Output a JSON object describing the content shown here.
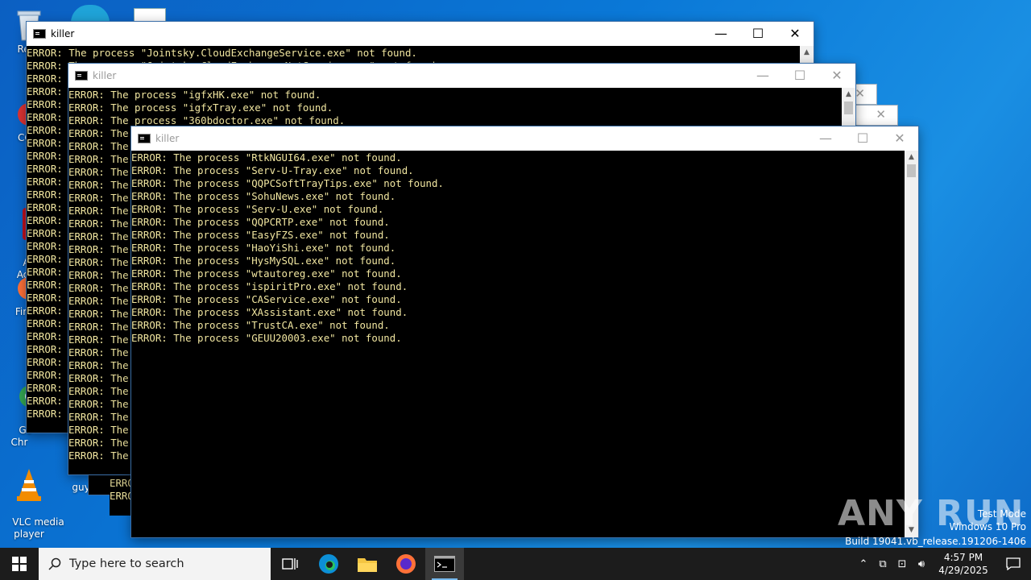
{
  "desktop_icons": [
    {
      "label": "Recy"
    },
    {
      "label": "CCl"
    },
    {
      "label": "Ac\nAc"
    },
    {
      "label": "Fir"
    },
    {
      "label": "Go\nChr"
    },
    {
      "label": "VLC media\nplayer"
    },
    {
      "label": "guypa"
    }
  ],
  "windows": {
    "back": {
      "title": "killer",
      "lines": [
        "ERROR: The process \"Jointsky.CloudExchangeService.exe\" not found.",
        "ERROR: The process \"Jointsky.CloudExchange.NetService.exe\" not found.",
        "ERROR:",
        "ERROR:",
        "ERROR:",
        "ERROR:",
        "ERROR:",
        "ERROR:",
        "ERROR:",
        "ERROR:",
        "ERROR:",
        "ERROR:",
        "ERROR:",
        "ERROR:",
        "ERROR:",
        "ERROR:",
        "ERROR:",
        "ERROR:",
        "ERROR:",
        "ERROR:",
        "ERROR:",
        "ERROR:",
        "ERROR:",
        "ERROR:",
        "ERROR:",
        "ERROR:",
        "ERROR:",
        "ERROR:",
        "ERROR:"
      ]
    },
    "middle": {
      "title": "killer",
      "lines": [
        "ERROR: The process \"igfxHK.exe\" not found.",
        "ERROR: The process \"igfxTray.exe\" not found.",
        "ERROR: The process \"360bdoctor.exe\" not found.",
        "ERROR: The",
        "ERROR: The",
        "ERROR: The",
        "ERROR: The",
        "ERROR: The",
        "ERROR: The",
        "ERROR: The",
        "ERROR: The",
        "ERROR: The",
        "ERROR: The",
        "ERROR: The",
        "ERROR: The",
        "ERROR: The",
        "ERROR: The",
        "ERROR: The",
        "ERROR: The",
        "ERROR: The",
        "ERROR: The",
        "ERROR: The",
        "ERROR: The",
        "ERROR: The",
        "ERROR: The",
        "ERROR: The",
        "ERROR: The",
        "ERROR: The",
        "ERROR: The"
      ]
    },
    "stack_a": {
      "lines": [
        "ERRO",
        "ERRO"
      ]
    },
    "front": {
      "title": "killer",
      "lines": [
        "ERROR: The process \"RtkNGUI64.exe\" not found.",
        "ERROR: The process \"Serv-U-Tray.exe\" not found.",
        "ERROR: The process \"QQPCSoftTrayTips.exe\" not found.",
        "ERROR: The process \"SohuNews.exe\" not found.",
        "ERROR: The process \"Serv-U.exe\" not found.",
        "ERROR: The process \"QQPCRTP.exe\" not found.",
        "ERROR: The process \"EasyFZS.exe\" not found.",
        "ERROR: The process \"HaoYiShi.exe\" not found.",
        "ERROR: The process \"HysMySQL.exe\" not found.",
        "ERROR: The process \"wtautoreg.exe\" not found.",
        "ERROR: The process \"ispiritPro.exe\" not found.",
        "ERROR: The process \"CAService.exe\" not found.",
        "ERROR: The process \"XAssistant.exe\" not found.",
        "ERROR: The process \"TrustCA.exe\" not found.",
        "ERROR: The process \"GEUU20003.exe\" not found."
      ]
    },
    "controls": {
      "minimize": "—",
      "maximize": "☐",
      "close": "✕"
    }
  },
  "watermark": {
    "mode": "Test Mode",
    "edition": "Windows 10 Pro",
    "build": "Build 19041.vb_release.191206-1406",
    "brand": "ANY RUN"
  },
  "taskbar": {
    "search_placeholder": "Type here to search",
    "time": "4:57 PM",
    "date": "4/29/2025"
  },
  "colors": {
    "console_text": "#f1e6a0",
    "desktop": "#0a78d7",
    "taskbar": "#1c1c1c"
  }
}
